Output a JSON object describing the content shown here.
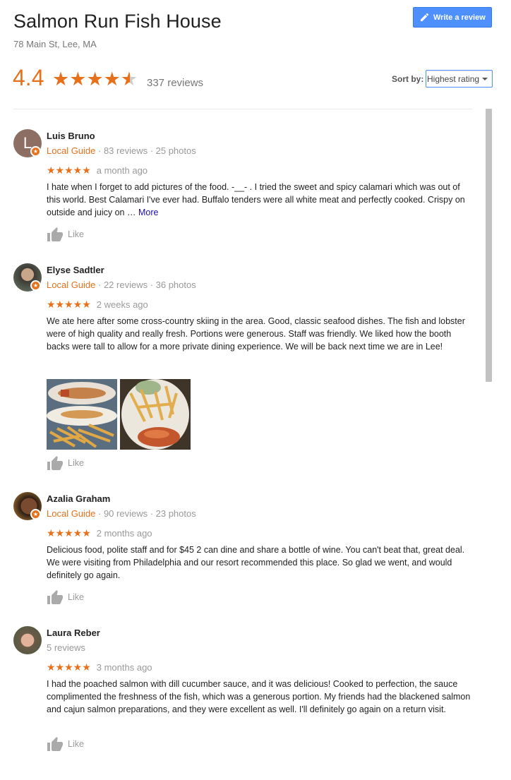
{
  "header": {
    "title": "Salmon Run Fish House",
    "address": "78 Main St, Lee, MA",
    "write_review_label": "Write a review",
    "rating": "4.4",
    "review_count": "337 reviews",
    "star_value": 4.4,
    "sort_label": "Sort by:",
    "sort_selected": "Highest rating"
  },
  "colors": {
    "accent": "#e7711b",
    "button": "#4d90fe",
    "link": "#1a0dab"
  },
  "reviews": [
    {
      "name": "Luis Bruno",
      "local_guide": "Local Guide",
      "stats": " · 83 reviews · 25 photos",
      "stars": "★★★★★",
      "date": "a month ago",
      "text": "I hate when I forget to add pictures of the food. -__- . I tried the sweet and spicy calamari which was out of this world. Best Calamari I've ever had. Buffalo tenders were all white meat and perfectly cooked. Crispy on outside and juicy on … ",
      "more": "More",
      "like": "Like",
      "avatar_letter": "L",
      "avatar_color": "#8d6e63"
    },
    {
      "name": "Elyse Sadtler",
      "local_guide": "Local Guide",
      "stats": " · 22 reviews · 36 photos",
      "stars": "★★★★★",
      "date": "2 weeks ago",
      "text": "We ate here after some cross-country skiing in the area. Good, classic seafood dishes. The fish and lobster were of high quality and really fresh. Portions were generous. Staff was friendly. We liked how the booth backs were tall to allow for a more private dining experience. We will be back next time we are in Lee!",
      "like": "Like"
    },
    {
      "name": "Azalia Graham",
      "local_guide": "Local Guide",
      "stats": " · 90 reviews · 23 photos",
      "stars": "★★★★★",
      "date": "2 months ago",
      "text": "Delicious food, polite staff and for $45 2 can dine and share a bottle of wine. You can't beat that, great deal. We were visiting from Philadelphia and our resort recommended this place. So glad we went, and would definitely go again.",
      "like": "Like"
    },
    {
      "name": "Laura Reber",
      "stats": "5 reviews",
      "stars": "★★★★★",
      "date": "3 months ago",
      "text": "I had the poached salmon with dill cucumber sauce, and it was delicious! Cooked to perfection,  the sauce complimented the freshness of the fish, which was a generous portion. My friends had the blackened salmon and cajun salmon preparations,  and they were excellent as well. I'll definitely go again on a return visit.",
      "like": "Like"
    }
  ]
}
